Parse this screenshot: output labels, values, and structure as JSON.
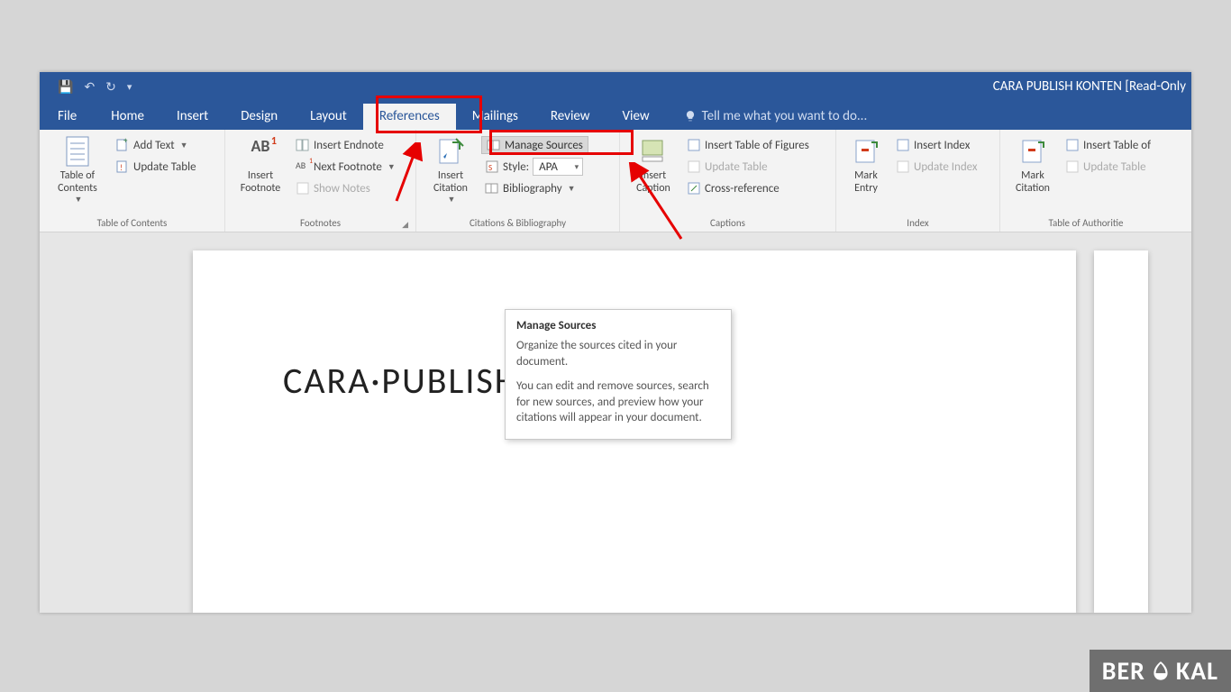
{
  "qat": {
    "save": "💾",
    "undo": "↶",
    "redo": "↻",
    "custom": "▾"
  },
  "title": "CARA PUBLISH KONTEN [Read-Only",
  "tabs": {
    "file": "File",
    "home": "Home",
    "insert": "Insert",
    "design": "Design",
    "layout": "Layout",
    "references": "References",
    "mailings": "Mailings",
    "review": "Review",
    "view": "View"
  },
  "tellme": "Tell me what you want to do...",
  "groups": {
    "toc": {
      "label": "Table of Contents",
      "big": "Table of\nContents",
      "add_text": "Add Text",
      "update_table": "Update Table"
    },
    "footnotes": {
      "label": "Footnotes",
      "big": "Insert\nFootnote",
      "insert_endnote": "Insert Endnote",
      "next_footnote": "Next Footnote",
      "show_notes": "Show Notes"
    },
    "citations": {
      "label": "Citations & Bibliography",
      "big": "Insert\nCitation",
      "manage_sources": "Manage Sources",
      "style_label": "Style:",
      "style_value": "APA",
      "bibliography": "Bibliography"
    },
    "captions": {
      "label": "Captions",
      "big": "Insert\nCaption",
      "itof": "Insert Table of Figures",
      "update_table": "Update Table",
      "cross_ref": "Cross-reference"
    },
    "index": {
      "label": "Index",
      "big": "Mark\nEntry",
      "insert_index": "Insert Index",
      "update_index": "Update Index"
    },
    "toa": {
      "label": "Table of Authoritie",
      "big": "Mark\nCitation",
      "insert_toa": "Insert Table of",
      "update_table": "Update Table"
    }
  },
  "tooltip": {
    "title": "Manage Sources",
    "p1": "Organize the sources cited in your document.",
    "p2": "You can edit and remove sources, search for new sources, and preview how your citations will appear in your document."
  },
  "document": {
    "heading": "CARA·PUBLISH·KONTEN"
  },
  "watermark": "BERAKAL"
}
